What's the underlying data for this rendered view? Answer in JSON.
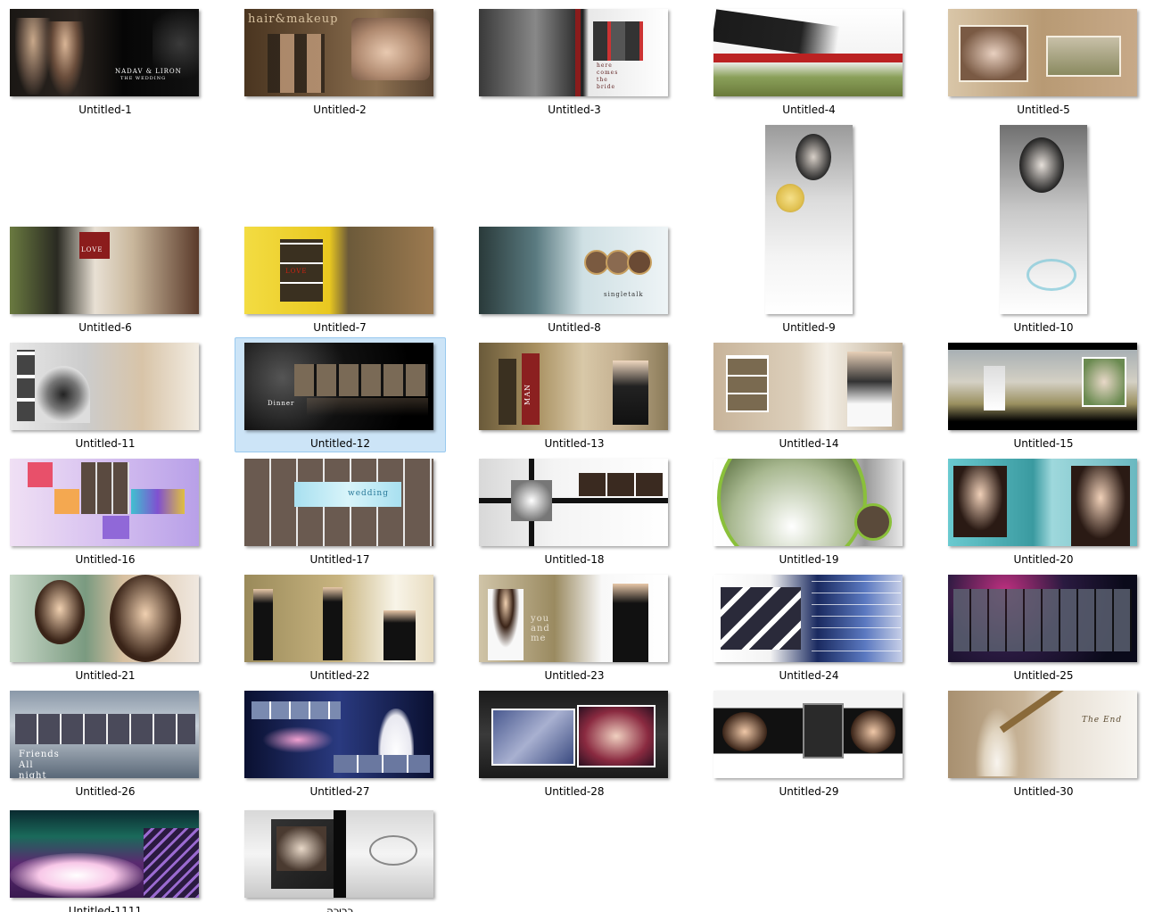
{
  "folder": {
    "view": "large-icons",
    "selected_index": 11,
    "items": [
      {
        "name": "Untitled-1"
      },
      {
        "name": "Untitled-2"
      },
      {
        "name": "Untitled-3"
      },
      {
        "name": "Untitled-4"
      },
      {
        "name": "Untitled-5"
      },
      {
        "name": "Untitled-6"
      },
      {
        "name": "Untitled-7"
      },
      {
        "name": "Untitled-8"
      },
      {
        "name": "Untitled-9"
      },
      {
        "name": "Untitled-10"
      },
      {
        "name": "Untitled-11"
      },
      {
        "name": "Untitled-12"
      },
      {
        "name": "Untitled-13"
      },
      {
        "name": "Untitled-14"
      },
      {
        "name": "Untitled-15"
      },
      {
        "name": "Untitled-16"
      },
      {
        "name": "Untitled-17"
      },
      {
        "name": "Untitled-18"
      },
      {
        "name": "Untitled-19"
      },
      {
        "name": "Untitled-20"
      },
      {
        "name": "Untitled-21"
      },
      {
        "name": "Untitled-22"
      },
      {
        "name": "Untitled-23"
      },
      {
        "name": "Untitled-24"
      },
      {
        "name": "Untitled-25"
      },
      {
        "name": "Untitled-26"
      },
      {
        "name": "Untitled-27"
      },
      {
        "name": "Untitled-28"
      },
      {
        "name": "Untitled-29"
      },
      {
        "name": "Untitled-30"
      },
      {
        "name": "Untitled-1111"
      },
      {
        "name": "כריכה"
      }
    ]
  },
  "thumb_text": {
    "t1": "NADAV & LIRON",
    "t1b": "THE WEDDING",
    "t2": "hair&makeup",
    "t3": "here comes the bride",
    "t7": "LOVE",
    "t8": "singletalk",
    "t12": "Dinner",
    "t13": "MAN",
    "t17": "wedding",
    "t23": "you and me",
    "t26": "Friends All night",
    "t30": "The End"
  },
  "colors": {
    "selection_fill": "#cce4f7",
    "selection_border": "#99c9ef",
    "caption_text": "#000000",
    "background": "#ffffff"
  }
}
